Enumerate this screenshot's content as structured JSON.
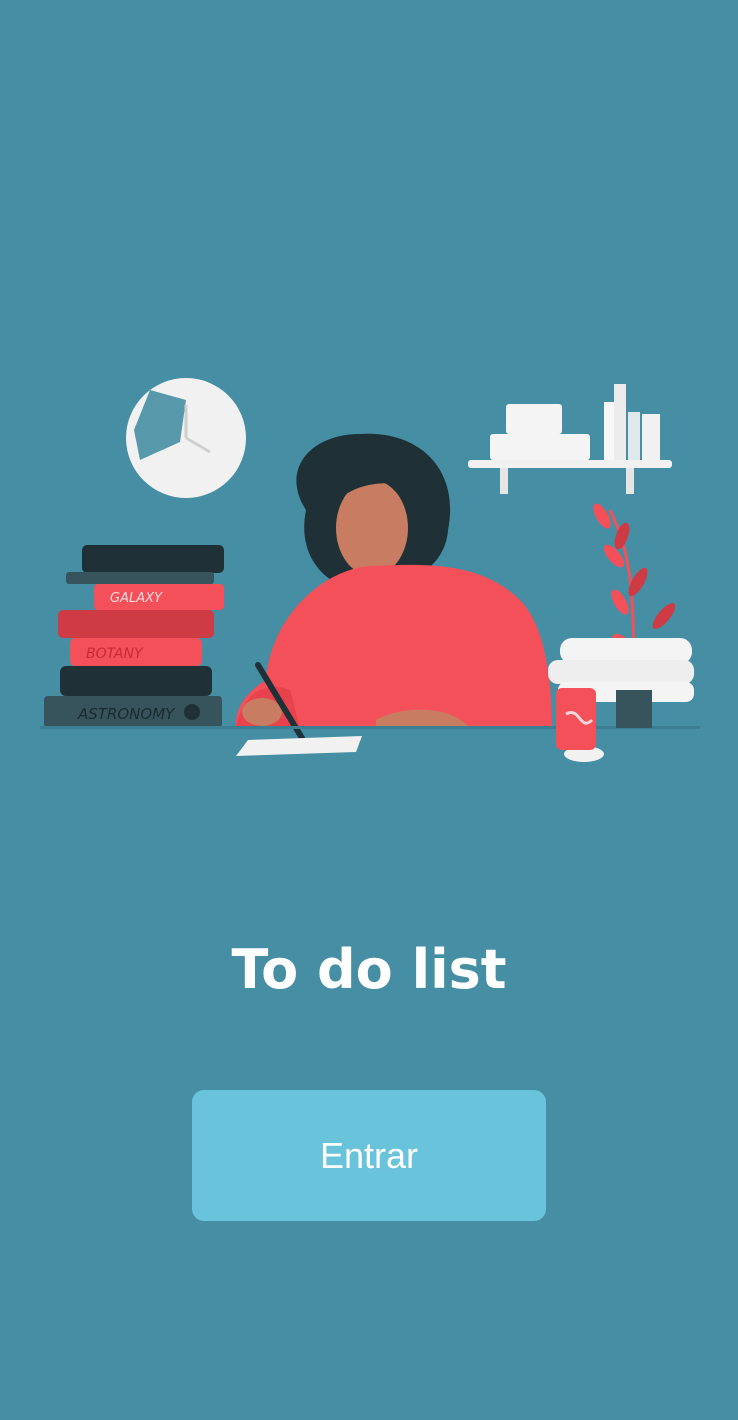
{
  "app": {
    "title": "To do list",
    "enter_label": "Entrar"
  },
  "illustration": {
    "book_labels": [
      "GALAXY",
      "BOTANY",
      "ASTRONOMY"
    ]
  },
  "colors": {
    "background": "#468ea3",
    "button": "#68c3db",
    "accent_red": "#f35059",
    "dark": "#1f3137"
  }
}
